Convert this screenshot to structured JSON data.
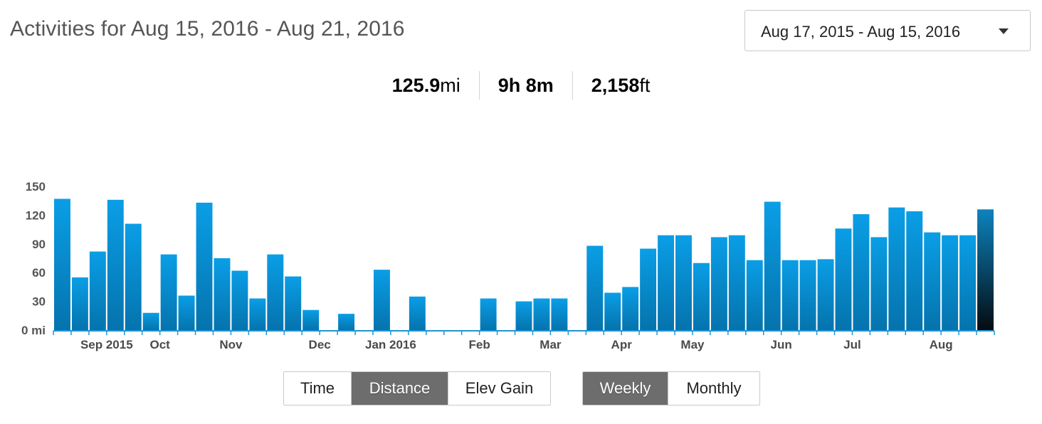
{
  "header": {
    "title": "Activities for Aug 15, 2016 - Aug 21, 2016",
    "date_range_value": "Aug 17, 2015 - Aug 15, 2016"
  },
  "stats": [
    {
      "value": "125.9",
      "unit": "mi"
    },
    {
      "value": "9h 8m",
      "unit": ""
    },
    {
      "value": "2,158",
      "unit": "ft"
    }
  ],
  "metric_toggle": {
    "options": [
      "Time",
      "Distance",
      "Elev Gain"
    ],
    "selected": "Distance"
  },
  "period_toggle": {
    "options": [
      "Weekly",
      "Monthly"
    ],
    "selected": "Weekly"
  },
  "colors": {
    "bar_top": "#0a9ee6",
    "bar_bottom": "#0573ad",
    "selected_top": "#0d83bd",
    "selected_bottom": "#040b10",
    "axis": "#1f95d4",
    "tick_text": "#555555",
    "month_text": "#4a4a4a"
  },
  "chart_data": {
    "type": "bar",
    "ylabel": "",
    "ylim": [
      0,
      150
    ],
    "yticks": [
      "0 mi",
      "30",
      "60",
      "90",
      "120",
      "150"
    ],
    "ytick_values": [
      0,
      30,
      60,
      90,
      120,
      150
    ],
    "x_month_labels": [
      {
        "label": "Sep 2015",
        "week_index": 3
      },
      {
        "label": "Oct",
        "week_index": 6
      },
      {
        "label": "Nov",
        "week_index": 10
      },
      {
        "label": "Dec",
        "week_index": 15
      },
      {
        "label": "Jan 2016",
        "week_index": 19
      },
      {
        "label": "Feb",
        "week_index": 24
      },
      {
        "label": "Mar",
        "week_index": 28
      },
      {
        "label": "Apr",
        "week_index": 32
      },
      {
        "label": "May",
        "week_index": 36
      },
      {
        "label": "Jun",
        "week_index": 41
      },
      {
        "label": "Jul",
        "week_index": 45
      },
      {
        "label": "Aug",
        "week_index": 50
      }
    ],
    "weeks": 53,
    "values": [
      137,
      55,
      82,
      136,
      111,
      18,
      79,
      36,
      133,
      75,
      62,
      33,
      79,
      56,
      21,
      0,
      17,
      0,
      63,
      0,
      35,
      0,
      0,
      0,
      33,
      0,
      30,
      33,
      33,
      0,
      88,
      39,
      45,
      85,
      99,
      99,
      70,
      97,
      99,
      73,
      134,
      73,
      73,
      74,
      106,
      121,
      97,
      128,
      124,
      102,
      99,
      99,
      126
    ],
    "selected_index": 52
  }
}
